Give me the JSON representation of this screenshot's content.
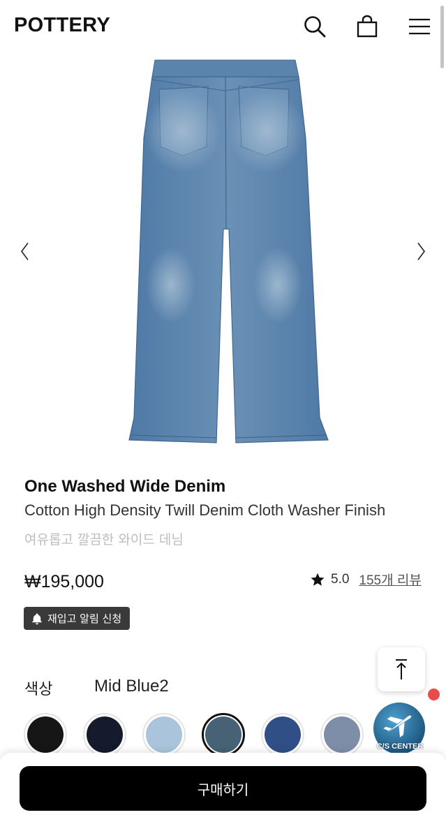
{
  "header": {
    "logo": "POTTERY",
    "icons": [
      "search-icon",
      "shopping-bag-icon",
      "menu-icon"
    ]
  },
  "gallery": {
    "prev_arrow": "‹",
    "next_arrow": "›"
  },
  "product": {
    "name": "One Washed Wide Denim",
    "subtitle": "Cotton High Density Twill Denim Cloth Washer Finish",
    "description": "여유롭고 깔끔한 와이드 데님",
    "price": "₩195,000",
    "rating": "5.0",
    "reviews": "155개 리뷰",
    "restock_label": "재입고 알림 신청"
  },
  "options": {
    "color_label": "색상",
    "selected_color": "Mid Blue2",
    "swatches": [
      {
        "color": "#161616"
      },
      {
        "color": "#151b2c"
      },
      {
        "color": "#a9c4db"
      },
      {
        "color": "#466274",
        "selected": true
      },
      {
        "color": "#2f4f86"
      },
      {
        "color": "#7f8ea8"
      }
    ]
  },
  "floating": {
    "cs_center_label": "C/S CENTER",
    "notification_color": "#e94a4a"
  },
  "footer": {
    "buy_label": "구매하기"
  }
}
